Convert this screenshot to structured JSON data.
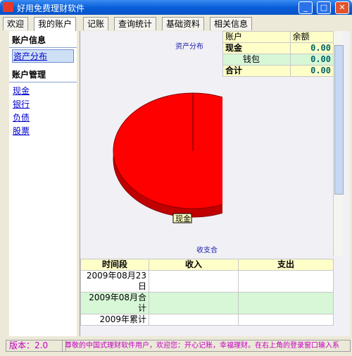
{
  "window": {
    "title": "好用免费理财软件",
    "buttons": [
      "_",
      "□",
      "✕"
    ]
  },
  "tabs": [
    "欢迎",
    "我的账户",
    "记账",
    "查询统计",
    "基础资料",
    "相关信息"
  ],
  "sidebar": {
    "section1_title": "账户信息",
    "section1_items": [
      "资产分布"
    ],
    "section2_title": "账户管理",
    "section2_items": [
      "现金",
      "银行",
      "负债",
      "股票"
    ]
  },
  "chart_data": {
    "type": "pie",
    "title": "资产分布",
    "categories": [
      "现金"
    ],
    "values": [
      100
    ],
    "colors": [
      "#ff0000"
    ],
    "footer": "收支合计"
  },
  "account_table": {
    "headers": [
      "账户",
      "余额"
    ],
    "rows": [
      {
        "name": "现金",
        "value": "0.00"
      },
      {
        "name": "钱包",
        "value": "0.00"
      },
      {
        "name": "合计",
        "value": "0.00"
      }
    ]
  },
  "period_table": {
    "headers": [
      "时间段",
      "收入",
      "支出"
    ],
    "rows": [
      [
        "2009年08月23日",
        "",
        ""
      ],
      [
        "2009年08月合计",
        "",
        ""
      ],
      [
        "2009年累计",
        "",
        ""
      ]
    ]
  },
  "statusbar": {
    "version": "版本：2.0",
    "message": "尊敬的中国式理财软件用户，欢迎您：开心记账，幸福理财。在右上角的登录窗口输入系"
  }
}
